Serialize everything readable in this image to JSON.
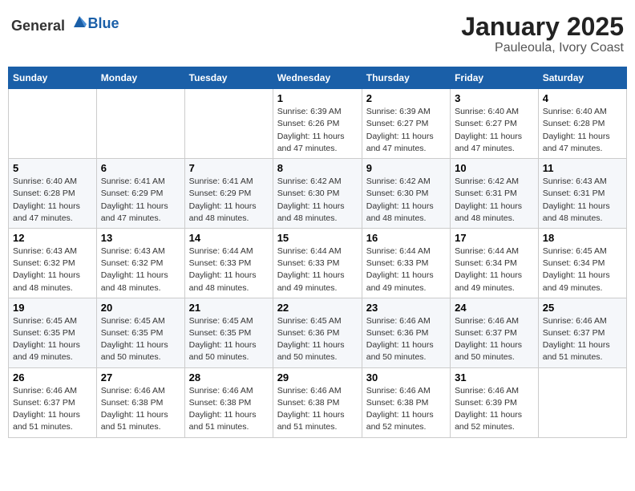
{
  "header": {
    "logo_general": "General",
    "logo_blue": "Blue",
    "month": "January 2025",
    "location": "Pauleoula, Ivory Coast"
  },
  "weekdays": [
    "Sunday",
    "Monday",
    "Tuesday",
    "Wednesday",
    "Thursday",
    "Friday",
    "Saturday"
  ],
  "weeks": [
    [
      {
        "day": "",
        "info": ""
      },
      {
        "day": "",
        "info": ""
      },
      {
        "day": "",
        "info": ""
      },
      {
        "day": "1",
        "info": "Sunrise: 6:39 AM\nSunset: 6:26 PM\nDaylight: 11 hours\nand 47 minutes."
      },
      {
        "day": "2",
        "info": "Sunrise: 6:39 AM\nSunset: 6:27 PM\nDaylight: 11 hours\nand 47 minutes."
      },
      {
        "day": "3",
        "info": "Sunrise: 6:40 AM\nSunset: 6:27 PM\nDaylight: 11 hours\nand 47 minutes."
      },
      {
        "day": "4",
        "info": "Sunrise: 6:40 AM\nSunset: 6:28 PM\nDaylight: 11 hours\nand 47 minutes."
      }
    ],
    [
      {
        "day": "5",
        "info": "Sunrise: 6:40 AM\nSunset: 6:28 PM\nDaylight: 11 hours\nand 47 minutes."
      },
      {
        "day": "6",
        "info": "Sunrise: 6:41 AM\nSunset: 6:29 PM\nDaylight: 11 hours\nand 47 minutes."
      },
      {
        "day": "7",
        "info": "Sunrise: 6:41 AM\nSunset: 6:29 PM\nDaylight: 11 hours\nand 48 minutes."
      },
      {
        "day": "8",
        "info": "Sunrise: 6:42 AM\nSunset: 6:30 PM\nDaylight: 11 hours\nand 48 minutes."
      },
      {
        "day": "9",
        "info": "Sunrise: 6:42 AM\nSunset: 6:30 PM\nDaylight: 11 hours\nand 48 minutes."
      },
      {
        "day": "10",
        "info": "Sunrise: 6:42 AM\nSunset: 6:31 PM\nDaylight: 11 hours\nand 48 minutes."
      },
      {
        "day": "11",
        "info": "Sunrise: 6:43 AM\nSunset: 6:31 PM\nDaylight: 11 hours\nand 48 minutes."
      }
    ],
    [
      {
        "day": "12",
        "info": "Sunrise: 6:43 AM\nSunset: 6:32 PM\nDaylight: 11 hours\nand 48 minutes."
      },
      {
        "day": "13",
        "info": "Sunrise: 6:43 AM\nSunset: 6:32 PM\nDaylight: 11 hours\nand 48 minutes."
      },
      {
        "day": "14",
        "info": "Sunrise: 6:44 AM\nSunset: 6:33 PM\nDaylight: 11 hours\nand 48 minutes."
      },
      {
        "day": "15",
        "info": "Sunrise: 6:44 AM\nSunset: 6:33 PM\nDaylight: 11 hours\nand 49 minutes."
      },
      {
        "day": "16",
        "info": "Sunrise: 6:44 AM\nSunset: 6:33 PM\nDaylight: 11 hours\nand 49 minutes."
      },
      {
        "day": "17",
        "info": "Sunrise: 6:44 AM\nSunset: 6:34 PM\nDaylight: 11 hours\nand 49 minutes."
      },
      {
        "day": "18",
        "info": "Sunrise: 6:45 AM\nSunset: 6:34 PM\nDaylight: 11 hours\nand 49 minutes."
      }
    ],
    [
      {
        "day": "19",
        "info": "Sunrise: 6:45 AM\nSunset: 6:35 PM\nDaylight: 11 hours\nand 49 minutes."
      },
      {
        "day": "20",
        "info": "Sunrise: 6:45 AM\nSunset: 6:35 PM\nDaylight: 11 hours\nand 50 minutes."
      },
      {
        "day": "21",
        "info": "Sunrise: 6:45 AM\nSunset: 6:35 PM\nDaylight: 11 hours\nand 50 minutes."
      },
      {
        "day": "22",
        "info": "Sunrise: 6:45 AM\nSunset: 6:36 PM\nDaylight: 11 hours\nand 50 minutes."
      },
      {
        "day": "23",
        "info": "Sunrise: 6:46 AM\nSunset: 6:36 PM\nDaylight: 11 hours\nand 50 minutes."
      },
      {
        "day": "24",
        "info": "Sunrise: 6:46 AM\nSunset: 6:37 PM\nDaylight: 11 hours\nand 50 minutes."
      },
      {
        "day": "25",
        "info": "Sunrise: 6:46 AM\nSunset: 6:37 PM\nDaylight: 11 hours\nand 51 minutes."
      }
    ],
    [
      {
        "day": "26",
        "info": "Sunrise: 6:46 AM\nSunset: 6:37 PM\nDaylight: 11 hours\nand 51 minutes."
      },
      {
        "day": "27",
        "info": "Sunrise: 6:46 AM\nSunset: 6:38 PM\nDaylight: 11 hours\nand 51 minutes."
      },
      {
        "day": "28",
        "info": "Sunrise: 6:46 AM\nSunset: 6:38 PM\nDaylight: 11 hours\nand 51 minutes."
      },
      {
        "day": "29",
        "info": "Sunrise: 6:46 AM\nSunset: 6:38 PM\nDaylight: 11 hours\nand 51 minutes."
      },
      {
        "day": "30",
        "info": "Sunrise: 6:46 AM\nSunset: 6:38 PM\nDaylight: 11 hours\nand 52 minutes."
      },
      {
        "day": "31",
        "info": "Sunrise: 6:46 AM\nSunset: 6:39 PM\nDaylight: 11 hours\nand 52 minutes."
      },
      {
        "day": "",
        "info": ""
      }
    ]
  ]
}
